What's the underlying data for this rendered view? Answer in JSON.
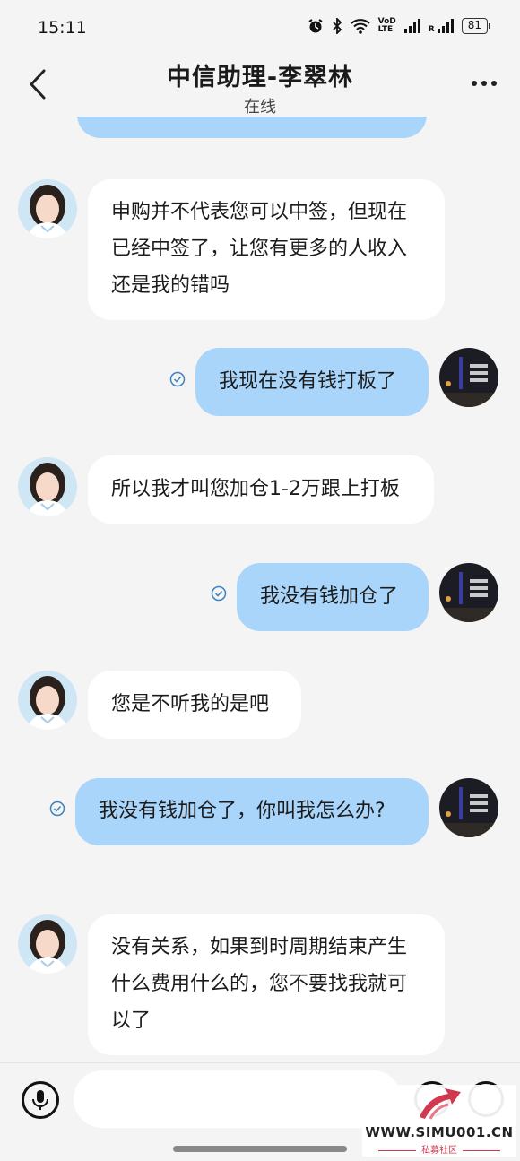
{
  "status_bar": {
    "time": "15:11",
    "network_label_top": "VoD",
    "network_label_bottom": "LTE",
    "roaming": "R",
    "battery": "81"
  },
  "header": {
    "title": "中信助理-李翠林",
    "subtitle": "在线"
  },
  "messages": [
    {
      "from": "contact",
      "text": "申购并不代表您可以中签，但现在已经中签了，让您有更多的人收入还是我的错吗"
    },
    {
      "from": "me",
      "text": "我现在没有钱打板了",
      "status": "read"
    },
    {
      "from": "contact",
      "text": "所以我才叫您加仓1-2万跟上打板"
    },
    {
      "from": "me",
      "text": "我没有钱加仓了",
      "status": "read"
    },
    {
      "from": "contact",
      "text": "您是不听我的是吧"
    },
    {
      "from": "me",
      "text": "我没有钱加仓了，你叫我怎么办?",
      "status": "read"
    },
    {
      "from": "contact",
      "text": "没有关系，如果到时周期结束产生什么费用什么的，您不要找我就可以了"
    }
  ],
  "input": {
    "placeholder": ""
  },
  "watermark": {
    "site": "WWW.SIMU001.CN",
    "tagline": "私募社区"
  },
  "colors": {
    "background": "#f4f4f4",
    "incoming_bubble": "#ffffff",
    "outgoing_bubble": "#a9d5fb",
    "read_check": "#3b82c4"
  }
}
